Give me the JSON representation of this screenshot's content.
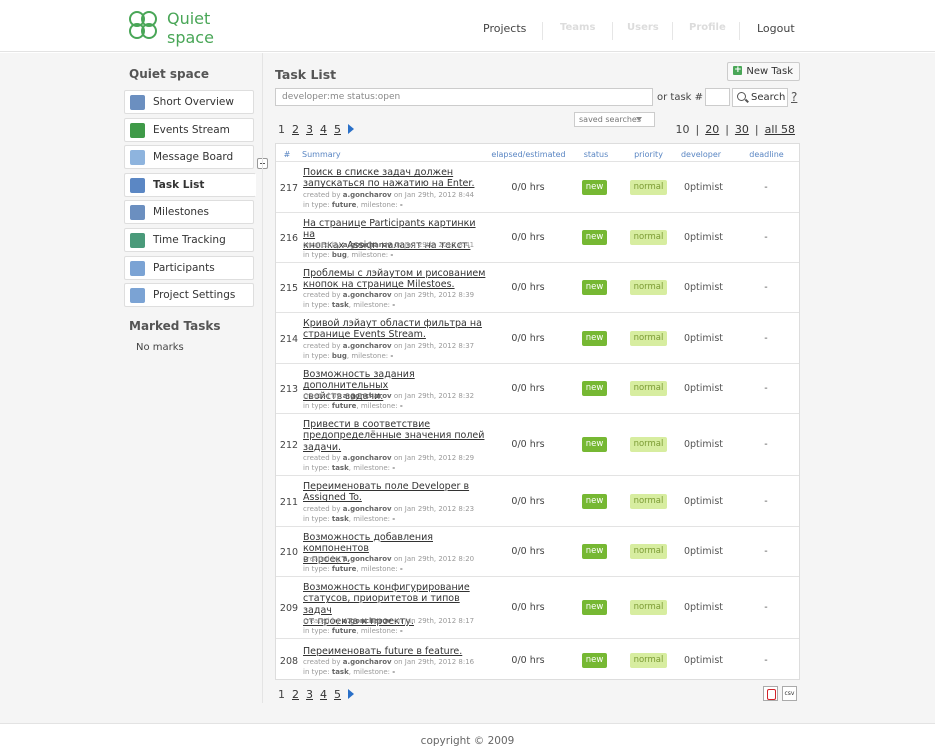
{
  "header": {
    "logo_line1": "Quiet",
    "logo_line2": "space",
    "nav": [
      {
        "label": "Projects",
        "enabled": true
      },
      {
        "label": "Teams",
        "enabled": false
      },
      {
        "label": "Users",
        "enabled": false
      },
      {
        "label": "Profile",
        "enabled": false
      },
      {
        "label": "Logout",
        "enabled": true
      }
    ]
  },
  "sidebar": {
    "title": "Quiet space",
    "items": [
      {
        "label": "Short Overview",
        "icon": "overview-icon",
        "color": "#6b8fc0"
      },
      {
        "label": "Events Stream",
        "icon": "events-icon",
        "color": "#3f9a48"
      },
      {
        "label": "Message Board",
        "icon": "message-icon",
        "color": "#8eb4de"
      },
      {
        "label": "Task List",
        "icon": "task-icon",
        "color": "#5b87c4",
        "active": true
      },
      {
        "label": "Milestones",
        "icon": "milestones-icon",
        "color": "#6b8fc0"
      },
      {
        "label": "Time Tracking",
        "icon": "clock-icon",
        "color": "#4a9a7a"
      },
      {
        "label": "Participants",
        "icon": "users-icon",
        "color": "#7ba3d4"
      },
      {
        "label": "Project Settings",
        "icon": "gear-icon",
        "color": "#7ba3d4"
      }
    ],
    "marked_title": "Marked Tasks",
    "marked_empty": "No marks"
  },
  "content": {
    "title": "Task List",
    "new_task": "New Task",
    "filter_value": "developer:me status:open",
    "or_task": "or task #",
    "search": "Search",
    "help": "?",
    "saved_searches": "saved searches",
    "pages": [
      "1",
      "2",
      "3",
      "4",
      "5"
    ],
    "perpage": {
      "current": "10",
      "options": [
        "20",
        "30",
        "all 58"
      ],
      "sep": "|"
    },
    "columns": [
      "#",
      "Summary",
      "elapsed/estimated",
      "status",
      "priority",
      "developer",
      "deadline"
    ],
    "meta_created_by": "created by",
    "meta_on": "on",
    "meta_in_type": "in type:",
    "meta_milestone": "milestone:",
    "tasks": [
      {
        "id": "217",
        "lines": [
          "Поиск в списке задач должен",
          "запускаться по нажатию на Enter."
        ],
        "author": "a.goncharov",
        "date": "Jan 29th, 2012 8:44",
        "type": "future",
        "milestone": "-",
        "elapsed": "0/0 hrs",
        "status": "new",
        "priority": "normal",
        "developer": "0ptimist",
        "deadline": "-"
      },
      {
        "id": "216",
        "lines": [
          "На странице Participants картинки на",
          "кнопках Assign налазят на текст."
        ],
        "author": "a.goncharov",
        "date": "Jan 29th, 2012 8:41",
        "type": "bug",
        "milestone": "-",
        "elapsed": "0/0 hrs",
        "status": "new",
        "priority": "normal",
        "developer": "0ptimist",
        "deadline": "-"
      },
      {
        "id": "215",
        "lines": [
          "Проблемы с лэйаутом и рисованием",
          "кнопок на странице Milestoes."
        ],
        "author": "a.goncharov",
        "date": "Jan 29th, 2012 8:39",
        "type": "task",
        "milestone": "-",
        "elapsed": "0/0 hrs",
        "status": "new",
        "priority": "normal",
        "developer": "0ptimist",
        "deadline": "-"
      },
      {
        "id": "214",
        "lines": [
          "Кривой лэйаут области фильтра на",
          "странице Events Stream."
        ],
        "author": "a.goncharov",
        "date": "Jan 29th, 2012 8:37",
        "type": "bug",
        "milestone": "-",
        "elapsed": "0/0 hrs",
        "status": "new",
        "priority": "normal",
        "developer": "0ptimist",
        "deadline": "-"
      },
      {
        "id": "213",
        "lines": [
          "Возможность задания дополнительных",
          "свойств задачи."
        ],
        "author": "a.goncharov",
        "date": "Jan 29th, 2012 8:32",
        "type": "future",
        "milestone": "-",
        "elapsed": "0/0 hrs",
        "status": "new",
        "priority": "normal",
        "developer": "0ptimist",
        "deadline": "-"
      },
      {
        "id": "212",
        "lines": [
          "Привести в соответствие",
          "предопределённые значения полей",
          "задачи."
        ],
        "author": "a.goncharov",
        "date": "Jan 29th, 2012 8:29",
        "type": "task",
        "milestone": "-",
        "elapsed": "0/0 hrs",
        "status": "new",
        "priority": "normal",
        "developer": "0ptimist",
        "deadline": "-"
      },
      {
        "id": "211",
        "lines": [
          "Переименовать поле Developer в",
          "Assigned To."
        ],
        "author": "a.goncharov",
        "date": "Jan 29th, 2012 8:23",
        "type": "task",
        "milestone": "-",
        "elapsed": "0/0 hrs",
        "status": "new",
        "priority": "normal",
        "developer": "0ptimist",
        "deadline": "-"
      },
      {
        "id": "210",
        "lines": [
          "Возможность добавления компонентов",
          "в проект."
        ],
        "author": "a.goncharov",
        "date": "Jan 29th, 2012 8:20",
        "type": "future",
        "milestone": "-",
        "elapsed": "0/0 hrs",
        "status": "new",
        "priority": "normal",
        "developer": "0ptimist",
        "deadline": "-"
      },
      {
        "id": "209",
        "lines": [
          "Возможность конфигурирование",
          "статусов, приоритетов и типов задач",
          "от проекта к проекту."
        ],
        "author": "a.goncharov",
        "date": "Jan 29th, 2012 8:17",
        "type": "future",
        "milestone": "-",
        "elapsed": "0/0 hrs",
        "status": "new",
        "priority": "normal",
        "developer": "0ptimist",
        "deadline": "-"
      },
      {
        "id": "208",
        "lines": [
          "Переименовать future в feature."
        ],
        "author": "a.goncharov",
        "date": "Jan 29th, 2012 8:16",
        "type": "task",
        "milestone": "-",
        "elapsed": "0/0 hrs",
        "status": "new",
        "priority": "normal",
        "developer": "0ptimist",
        "deadline": "-"
      }
    ],
    "export_csv": "csv"
  },
  "footer": {
    "copyright": "copyright © 2009"
  }
}
